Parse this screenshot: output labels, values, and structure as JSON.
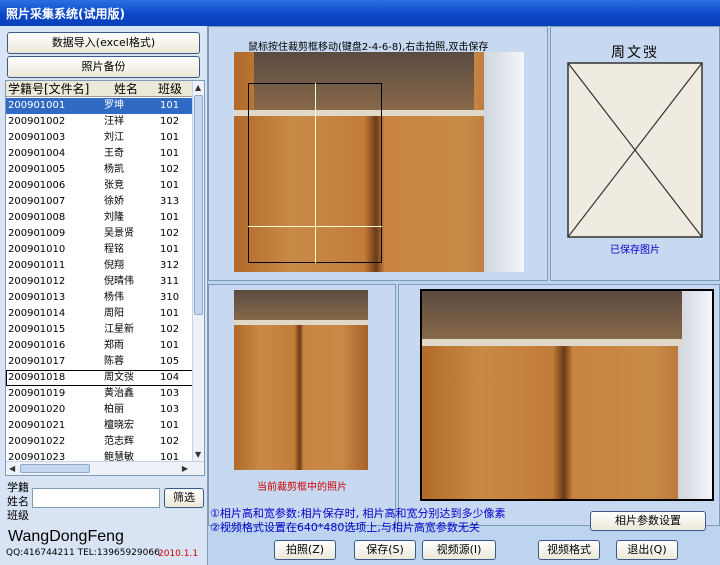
{
  "window": {
    "title": "照片采集系统(试用版)"
  },
  "left": {
    "import_button": "数据导入(excel格式)",
    "backup_button": "照片备份",
    "columns": [
      "学籍号[文件名]",
      "姓名",
      "班级"
    ],
    "students": [
      {
        "id": "200901001",
        "name": "罗坤",
        "cls": "101"
      },
      {
        "id": "200901002",
        "name": "汪祥",
        "cls": "102"
      },
      {
        "id": "200901003",
        "name": "刘江",
        "cls": "101"
      },
      {
        "id": "200901004",
        "name": "王奇",
        "cls": "101"
      },
      {
        "id": "200901005",
        "name": "杨凯",
        "cls": "102"
      },
      {
        "id": "200901006",
        "name": "张竞",
        "cls": "101"
      },
      {
        "id": "200901007",
        "name": "徐娇",
        "cls": "313"
      },
      {
        "id": "200901008",
        "name": "刘隆",
        "cls": "101"
      },
      {
        "id": "200901009",
        "name": "吴景贤",
        "cls": "102"
      },
      {
        "id": "200901010",
        "name": "程铭",
        "cls": "101"
      },
      {
        "id": "200901011",
        "name": "倪翔",
        "cls": "312"
      },
      {
        "id": "200901012",
        "name": "倪晴伟",
        "cls": "311"
      },
      {
        "id": "200901013",
        "name": "杨伟",
        "cls": "310"
      },
      {
        "id": "200901014",
        "name": "周阳",
        "cls": "101"
      },
      {
        "id": "200901015",
        "name": "江星新",
        "cls": "102"
      },
      {
        "id": "200901016",
        "name": "郑雨",
        "cls": "101"
      },
      {
        "id": "200901017",
        "name": "陈蓉",
        "cls": "105"
      },
      {
        "id": "200901018",
        "name": "周文弢",
        "cls": "104"
      },
      {
        "id": "200901019",
        "name": "黄治鑫",
        "cls": "103"
      },
      {
        "id": "200901020",
        "name": "柏丽",
        "cls": "103"
      },
      {
        "id": "200901021",
        "name": "檀晓宏",
        "cls": "101"
      },
      {
        "id": "200901022",
        "name": "范志辉",
        "cls": "102"
      },
      {
        "id": "200901023",
        "name": "鲍慧敏",
        "cls": "101"
      }
    ],
    "filter_label_1": "学籍",
    "filter_label_2": "姓名",
    "filter_label_3": "班级",
    "filter_value": "",
    "filter_button": "筛选",
    "author": "WangDongFeng",
    "contact": "QQ:416744211 TEL:13965929066",
    "date": "2010.1.1"
  },
  "main": {
    "instruction": "鼠标按住裁剪框移动(键盘2-4-6-8),右击拍照,双击保存",
    "student_name": "周文弢",
    "saved_label": "已保存图片",
    "crop_caption": "当前裁剪框中的照片",
    "note_1": "①相片高和宽参数:相片保存时, 相片高和宽分别达到多少像素",
    "note_2": "②视频格式设置在640*480选项上,与相片高宽参数无关",
    "param_button": "相片参数设置",
    "buttons": [
      "拍照(Z)",
      "保存(S)",
      "视频源(I)",
      "视频格式",
      "退出(Q)"
    ]
  },
  "colors": {
    "title": "#0a46c8",
    "selected": "#316ac5",
    "accent_text": "#0000cc",
    "red": "#d00000"
  }
}
